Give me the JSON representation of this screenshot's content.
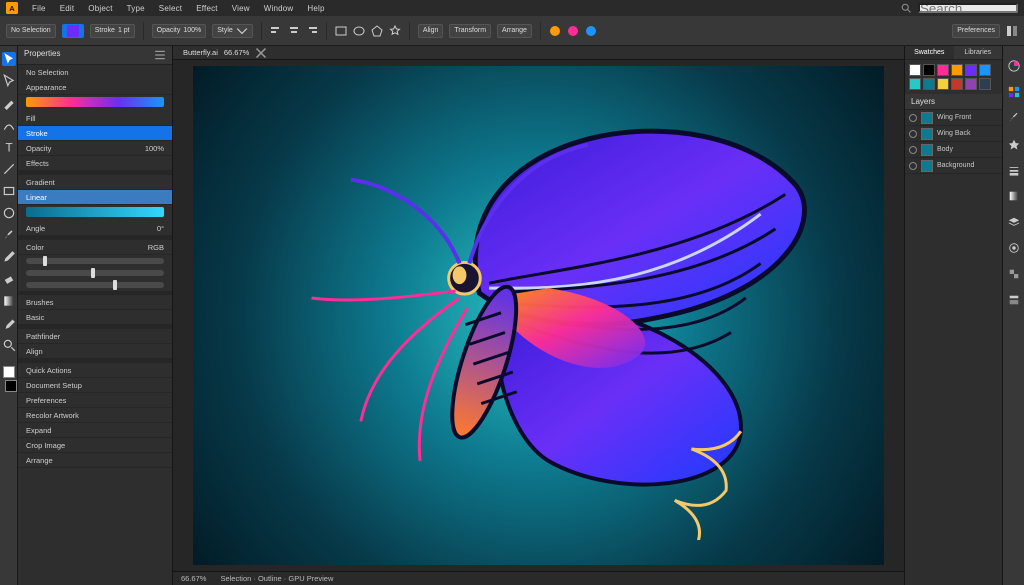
{
  "menu": {
    "items": [
      "File",
      "Edit",
      "Object",
      "Type",
      "Select",
      "Effect",
      "View",
      "Window",
      "Help"
    ],
    "search_placeholder": "Search…"
  },
  "optionsbar": {
    "doc_label": "No Selection",
    "stroke_label": "Stroke",
    "stroke_value": "1 pt",
    "opacity_label": "Opacity",
    "opacity_value": "100%",
    "style_label": "Style",
    "align_label": "Align",
    "transform_label": "Transform",
    "arrange_label": "Arrange",
    "preferences_label": "Preferences"
  },
  "left_panel": {
    "title": "Properties",
    "subtitle": "No Selection",
    "appearance": {
      "header": "Appearance",
      "fill_label": "Fill",
      "stroke_label": "Stroke",
      "opacity_label": "Opacity",
      "opacity_value": "100%",
      "effects_label": "Effects"
    },
    "gradient": {
      "header": "Gradient",
      "type_label": "Linear",
      "angle_label": "Angle",
      "angle_value": "0°"
    },
    "color": {
      "header": "Color",
      "mode": "RGB",
      "r": "20",
      "g": "120",
      "b": "160"
    },
    "brushes": {
      "header": "Brushes",
      "preset_label": "Basic"
    },
    "pathfinder": {
      "header": "Pathfinder"
    },
    "align": {
      "header": "Align"
    },
    "quick_actions": {
      "header": "Quick Actions",
      "doc_setup": "Document Setup",
      "prefs": "Preferences",
      "recolor": "Recolor Artwork",
      "expand": "Expand",
      "crop": "Crop Image",
      "arrange": "Arrange"
    }
  },
  "right_panel": {
    "tabs": [
      "Swatches",
      "Libraries"
    ],
    "layers_title": "Layers",
    "layers": [
      {
        "name": "Wing Front"
      },
      {
        "name": "Wing Back"
      },
      {
        "name": "Body"
      },
      {
        "name": "Background"
      }
    ],
    "swatches": [
      "#ffffff",
      "#000000",
      "#ff2d95",
      "#ff9a00",
      "#6a2ff7",
      "#1d93ff",
      "#2ac7c7",
      "#0e7a8f",
      "#f4d03f",
      "#c0392b",
      "#8e44ad",
      "#2c3e50"
    ]
  },
  "document": {
    "tab_title": "Butterfly.ai",
    "zoom": "66.67%",
    "statusbar": "Selection  ·  Outline  ·  GPU Preview"
  },
  "tools": [
    "selection",
    "direct-select",
    "pen",
    "curvature",
    "type",
    "line",
    "rectangle",
    "ellipse",
    "brush",
    "pencil",
    "eraser",
    "gradient",
    "eyedropper",
    "zoom"
  ],
  "colors": {
    "accent": "#1473e6"
  }
}
